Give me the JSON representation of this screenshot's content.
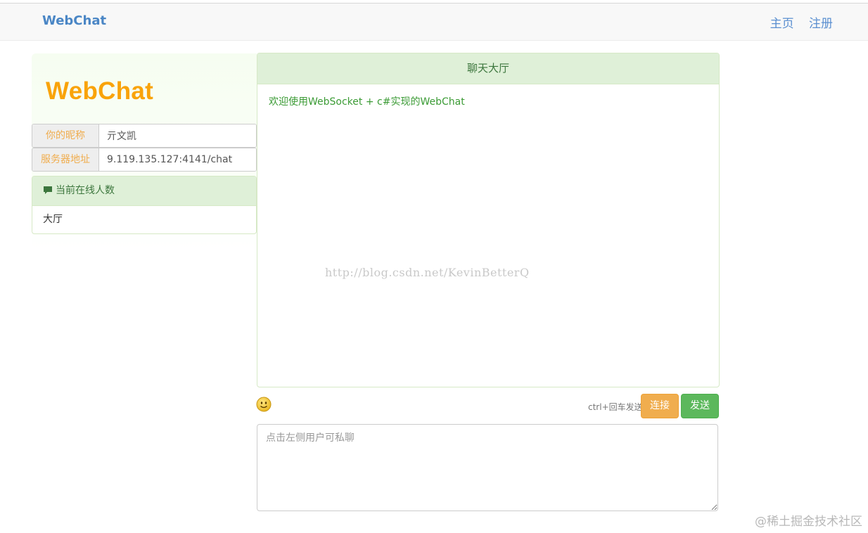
{
  "navbar": {
    "brand": "WebChat",
    "links": [
      "主页",
      "注册"
    ]
  },
  "sidebar": {
    "logo": "WebChat",
    "nickname_label": "你的昵称",
    "nickname_value": "亓文凯",
    "server_label": "服务器地址",
    "server_value": "9.119.135.127:4141/chat",
    "online_title": "当前在线人数",
    "online_items": [
      "大厅"
    ]
  },
  "chat": {
    "title": "聊天大厅",
    "messages": [
      "欢迎使用WebSocket + c#实现的WebChat"
    ],
    "watermark": "http://blog.csdn.net/KevinBetterQ"
  },
  "toolbar": {
    "emoji_icon": "smiley-face-icon",
    "hint": "ctrl+回车发送",
    "connect_label": "连接",
    "send_label": "发送"
  },
  "input": {
    "placeholder": "点击左侧用户可私聊"
  },
  "corner_watermark": "@稀土掘金技术社区",
  "colors": {
    "brand": "#4a86c5",
    "logo": "#f9a30a",
    "panel_green": "#dff0d8",
    "message_green": "#3b9b35",
    "warning": "#f0ad4e",
    "success": "#5cb85c"
  }
}
